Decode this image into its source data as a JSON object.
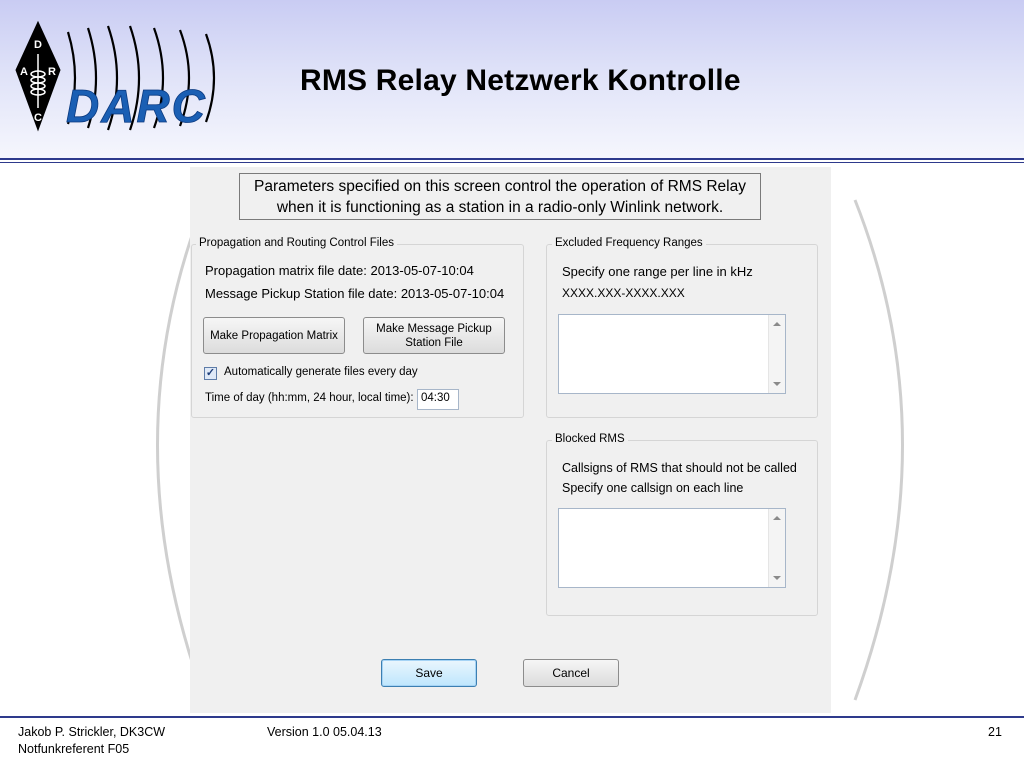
{
  "slide": {
    "title": "RMS Relay Netzwerk Kontrolle",
    "logo": {
      "diamond_letters": [
        "D",
        "A",
        "R",
        "C"
      ],
      "wordmark": "DARC"
    },
    "footer": {
      "author": "Jakob P. Strickler, DK3CW",
      "role": "Notfunkreferent F05",
      "version": "Version 1.0  05.04.13",
      "page": "21"
    }
  },
  "dialog": {
    "intro_line1": "Parameters specified on this screen control the operation of RMS Relay",
    "intro_line2": "when it is functioning as a station in a radio-only Winlink network.",
    "propagation": {
      "legend": "Propagation and Routing Control Files",
      "matrix_date": "Propagation matrix file date: 2013-05-07-10:04",
      "pickup_date": "Message Pickup Station file date: 2013-05-07-10:04",
      "make_matrix_button": "Make Propagation Matrix",
      "make_pickup_line1": "Make Message Pickup",
      "make_pickup_line2": "Station File",
      "auto_generate_label": "Automatically generate files every day",
      "auto_generate_checked": true,
      "time_label": "Time of day (hh:mm, 24 hour, local time):",
      "time_value": "04:30"
    },
    "excluded": {
      "legend": "Excluded Frequency Ranges",
      "hint": "Specify one range per line in kHz",
      "format": "XXXX.XXX-XXXX.XXX",
      "value": ""
    },
    "blocked": {
      "legend": "Blocked RMS",
      "hint1": "Callsigns of RMS that should not be called",
      "hint2": "Specify one callsign on each line",
      "value": ""
    },
    "save_button": "Save",
    "cancel_button": "Cancel"
  },
  "colors": {
    "header_gradient_top": "#c9ccf3",
    "rule_blue": "#2e3a8c",
    "logo_blue": "#1a5fb4",
    "dialog_bg": "#f0f0f0"
  }
}
